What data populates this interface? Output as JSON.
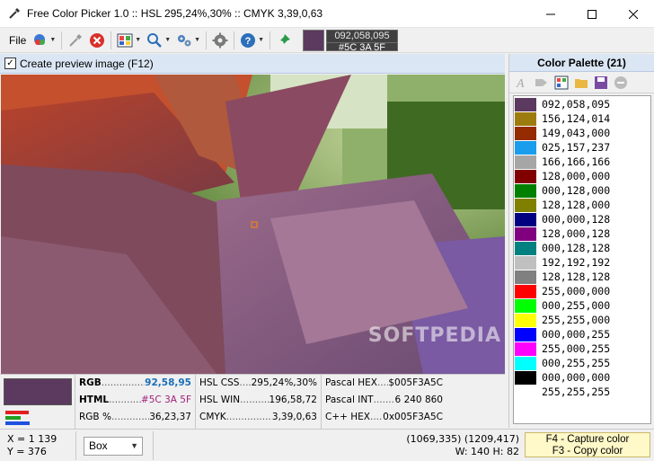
{
  "window": {
    "title": "Free Color Picker 1.0  ::  HSL 295,24%,30%  ::  CMYK 3,39,0,63"
  },
  "toolbar": {
    "file_label": "File",
    "current_color": {
      "rgb_dec": "092,058,095",
      "hex": "#5C  3A  5F",
      "swatch": "#5c3a5f"
    }
  },
  "preview": {
    "checkbox_label": "Create preview image (F12)",
    "checked": true,
    "watermark": "SOFTPEDIA"
  },
  "palette": {
    "title": "Color Palette (21)",
    "items": [
      {
        "label": "092,058,095",
        "color": "#5c3a5f"
      },
      {
        "label": "156,124,014",
        "color": "#9c7c0e"
      },
      {
        "label": "149,043,000",
        "color": "#952b00"
      },
      {
        "label": "025,157,237",
        "color": "#199ded"
      },
      {
        "label": "166,166,166",
        "color": "#a6a6a6"
      },
      {
        "label": "128,000,000",
        "color": "#800000"
      },
      {
        "label": "000,128,000",
        "color": "#008000"
      },
      {
        "label": "128,128,000",
        "color": "#808000"
      },
      {
        "label": "000,000,128",
        "color": "#000080"
      },
      {
        "label": "128,000,128",
        "color": "#800080"
      },
      {
        "label": "000,128,128",
        "color": "#008080"
      },
      {
        "label": "192,192,192",
        "color": "#c0c0c0"
      },
      {
        "label": "128,128,128",
        "color": "#808080"
      },
      {
        "label": "255,000,000",
        "color": "#ff0000"
      },
      {
        "label": "000,255,000",
        "color": "#00ff00"
      },
      {
        "label": "255,255,000",
        "color": "#ffff00"
      },
      {
        "label": "000,000,255",
        "color": "#0000ff"
      },
      {
        "label": "255,000,255",
        "color": "#ff00ff"
      },
      {
        "label": "000,255,255",
        "color": "#00ffff"
      },
      {
        "label": "000,000,000",
        "color": "#000000"
      },
      {
        "label": "255,255,255",
        "color": "#ffffff"
      }
    ]
  },
  "info": {
    "swatch": "#5c3a5f",
    "rgb_key": "RGB",
    "rgb_val": "92,58,95",
    "html_key": "HTML",
    "html_val": "#5C  3A  5F",
    "rgbpct_key": "RGB %",
    "rgbpct_val": "36,23,37",
    "hslcss_key": "HSL CSS",
    "hslcss_val": "295,24%,30%",
    "hslwin_key": "HSL WIN",
    "hslwin_val": "196,58,72",
    "cmyk_key": "CMYK",
    "cmyk_val": "3,39,0,63",
    "pashex_key": "Pascal HEX",
    "pashex_val": "$005F3A5C",
    "pasint_key": "Pascal INT",
    "pasint_val": "6 240 860",
    "cpphex_key": "C++ HEX",
    "cpphex_val": "0x005F3A5C"
  },
  "status": {
    "x": "X =  1 139",
    "y": "Y =  376",
    "mode": "Box",
    "rect": "(1069,335) (1209,417)",
    "size": "W: 140   H: 82",
    "hotkey1": "F4 - Capture color",
    "hotkey2": "F3 - Copy color"
  }
}
